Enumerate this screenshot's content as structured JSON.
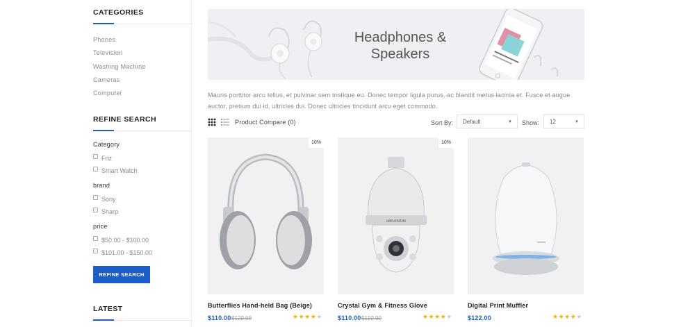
{
  "sidebar": {
    "categories_heading": "CATEGORIES",
    "categories": [
      "Phones",
      "Television",
      "Washing Machine",
      "Cameras",
      "Computer"
    ],
    "refine_heading": "REFINE SEARCH",
    "filters": [
      {
        "title": "Category",
        "options": [
          "Friz",
          "Smart Watch"
        ]
      },
      {
        "title": "brand",
        "options": [
          "Sony",
          "Sharp"
        ]
      },
      {
        "title": "price",
        "options": [
          "$50.00 - $100.00",
          "$101.00 - $150.00"
        ]
      }
    ],
    "refine_button": "REFINE SEARCH",
    "latest_heading": "LATEST"
  },
  "banner": {
    "title_line1": "Headphones &",
    "title_line2": "Speakers"
  },
  "description": "Mauris porttitor arcu tellus, et pulvinar sem tristique eu. Donec tempor ligula purus, ac blandit metus lacinia et. Fusce et augue auctor, pretium dui id, ultricies dui. Donec ultricies tincidunt arcu eget commodo.",
  "toolbar": {
    "grid_icon": "grid-view-icon",
    "list_icon": "list-view-icon",
    "compare": "Product Compare (0)",
    "sort_label": "Sort By:",
    "sort_value": "Default",
    "show_label": "Show:",
    "show_value": "12"
  },
  "products": [
    {
      "name": "Butterflies Hand-held Bag (Beige)",
      "price": "$110.00",
      "old_price": "$122.00",
      "badge": "10%",
      "rating": 4,
      "image": "headphones"
    },
    {
      "name": "Crystal Gym & Fitness Glove",
      "price": "$110.00",
      "old_price": "$122.00",
      "badge": "10%",
      "rating": 4,
      "image": "security-camera"
    },
    {
      "name": "Digital Print Muffler",
      "price": "$122.00",
      "old_price": "",
      "badge": "",
      "rating": 4,
      "image": "speaker"
    }
  ],
  "colors": {
    "accent": "#1c5ec9",
    "star": "#f5b301",
    "banner_bg": "#eef0f3",
    "product_bg": "#f1f1f1"
  }
}
